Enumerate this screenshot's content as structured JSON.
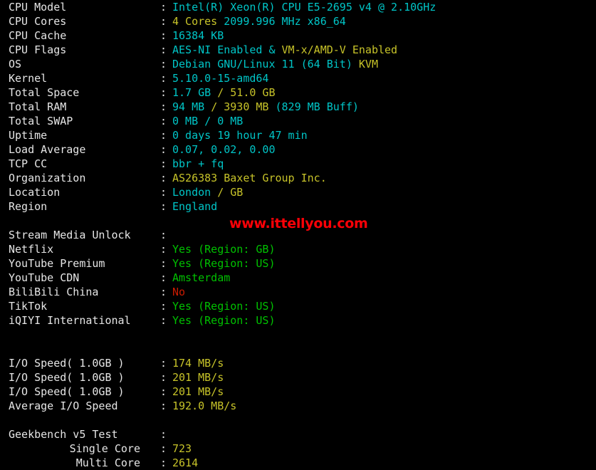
{
  "terminal": {
    "background": "#000000",
    "colors": {
      "label": "#e6e6e6",
      "cyan": "#00c5c7",
      "yellow": "#c7c329",
      "green": "#00c200",
      "red": "#c91b00",
      "watermark": "#fb0007"
    },
    "separator_char": "-",
    "separator_line": "- - - - - - - - - - - - - - - - - - - - - - - - - - - - - - - - - - - - - - - - - - - - - - - - - - - - -",
    "colon": ":"
  },
  "watermark": {
    "text": "www.ittellyou.com"
  },
  "sections": {
    "system": [
      {
        "label": "CPU Model",
        "parts": [
          {
            "text": "Intel(R) Xeon(R) CPU E5-2695 v4 @ 2.10GHz",
            "color": "cyan"
          }
        ]
      },
      {
        "label": "CPU Cores",
        "parts": [
          {
            "text": "4 Cores ",
            "color": "yellow"
          },
          {
            "text": "2099.996 MHz x86_64",
            "color": "cyan"
          }
        ]
      },
      {
        "label": "CPU Cache",
        "parts": [
          {
            "text": "16384 KB",
            "color": "cyan"
          }
        ]
      },
      {
        "label": "CPU Flags",
        "parts": [
          {
            "text": "AES-NI Enabled & ",
            "color": "cyan"
          },
          {
            "text": "VM-x/AMD-V Enabled",
            "color": "yellow"
          }
        ]
      },
      {
        "label": "OS",
        "parts": [
          {
            "text": "Debian GNU/Linux 11 (64 Bit) ",
            "color": "cyan"
          },
          {
            "text": "KVM",
            "color": "yellow"
          }
        ]
      },
      {
        "label": "Kernel",
        "parts": [
          {
            "text": "5.10.0-15-amd64",
            "color": "cyan"
          }
        ]
      },
      {
        "label": "Total Space",
        "parts": [
          {
            "text": "1.7 GB ",
            "color": "cyan"
          },
          {
            "text": "/ 51.0 GB",
            "color": "yellow"
          }
        ]
      },
      {
        "label": "Total RAM",
        "parts": [
          {
            "text": "94 MB ",
            "color": "cyan"
          },
          {
            "text": "/ 3930 MB ",
            "color": "yellow"
          },
          {
            "text": "(829 MB Buff)",
            "color": "cyan"
          }
        ]
      },
      {
        "label": "Total SWAP",
        "parts": [
          {
            "text": "0 MB / 0 MB",
            "color": "cyan"
          }
        ]
      },
      {
        "label": "Uptime",
        "parts": [
          {
            "text": "0 days 19 hour 47 min",
            "color": "cyan"
          }
        ]
      },
      {
        "label": "Load Average",
        "parts": [
          {
            "text": "0.07, 0.02, 0.00",
            "color": "cyan"
          }
        ]
      },
      {
        "label": "TCP CC",
        "parts": [
          {
            "text": "bbr + fq",
            "color": "cyan"
          }
        ]
      },
      {
        "label": "Organization",
        "parts": [
          {
            "text": "AS26383 Baxet Group Inc.",
            "color": "yellow"
          }
        ]
      },
      {
        "label": "Location",
        "parts": [
          {
            "text": "London ",
            "color": "cyan"
          },
          {
            "text": "/ GB",
            "color": "yellow"
          }
        ]
      },
      {
        "label": "Region",
        "parts": [
          {
            "text": "England",
            "color": "cyan"
          }
        ]
      }
    ],
    "stream_media": [
      {
        "label": "Stream Media Unlock",
        "parts": []
      },
      {
        "label": "Netflix",
        "parts": [
          {
            "text": "Yes (Region: GB)",
            "color": "green"
          }
        ]
      },
      {
        "label": "YouTube Premium",
        "parts": [
          {
            "text": "Yes (Region: US)",
            "color": "green"
          }
        ]
      },
      {
        "label": "YouTube CDN",
        "parts": [
          {
            "text": "Amsterdam",
            "color": "green"
          }
        ]
      },
      {
        "label": "BiliBili China",
        "parts": [
          {
            "text": "No",
            "color": "red"
          }
        ]
      },
      {
        "label": "TikTok",
        "parts": [
          {
            "text": "Yes (Region: US)",
            "color": "green"
          }
        ]
      },
      {
        "label": "iQIYI International",
        "parts": [
          {
            "text": "Yes (Region: US)",
            "color": "green"
          }
        ]
      }
    ],
    "io_speed": [
      {
        "label": "I/O Speed( 1.0GB )",
        "parts": [
          {
            "text": "174 MB/s",
            "color": "yellow"
          }
        ]
      },
      {
        "label": "I/O Speed( 1.0GB )",
        "parts": [
          {
            "text": "201 MB/s",
            "color": "yellow"
          }
        ]
      },
      {
        "label": "I/O Speed( 1.0GB )",
        "parts": [
          {
            "text": "201 MB/s",
            "color": "yellow"
          }
        ]
      },
      {
        "label": "Average I/O Speed",
        "parts": [
          {
            "text": "192.0 MB/s",
            "color": "yellow"
          }
        ]
      }
    ],
    "geekbench": [
      {
        "label": "Geekbench v5 Test",
        "parts": [],
        "indent": false
      },
      {
        "label": "Single Core",
        "parts": [
          {
            "text": "723",
            "color": "yellow"
          }
        ],
        "indent": true
      },
      {
        "label": "Multi Core",
        "parts": [
          {
            "text": "2614",
            "color": "yellow"
          }
        ],
        "indent": true
      }
    ]
  }
}
